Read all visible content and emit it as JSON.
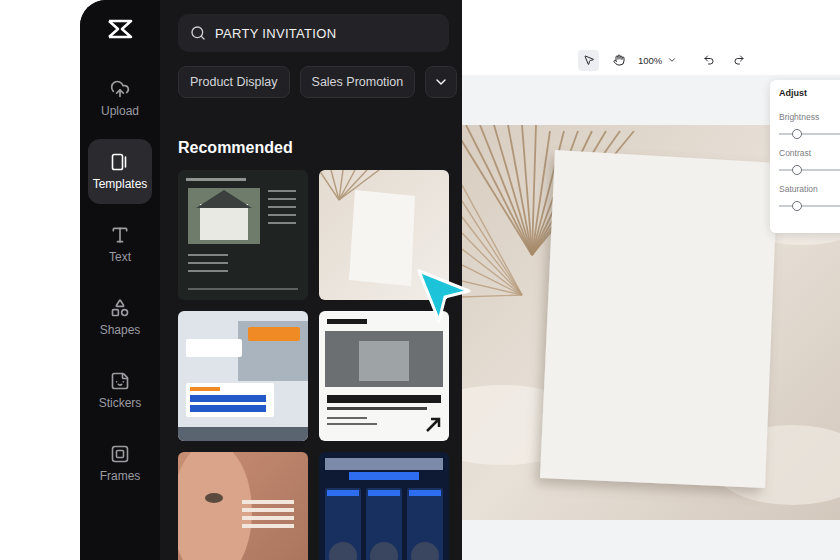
{
  "sidebar": {
    "items": [
      {
        "label": "Upload",
        "selected": false
      },
      {
        "label": "Templates",
        "selected": true
      },
      {
        "label": "Text",
        "selected": false
      },
      {
        "label": "Shapes",
        "selected": false
      },
      {
        "label": "Stickers",
        "selected": false
      },
      {
        "label": "Frames",
        "selected": false
      }
    ]
  },
  "search": {
    "value": "PARTY INVITATION"
  },
  "filters": [
    {
      "label": "Product Display"
    },
    {
      "label": "Sales Promotion"
    }
  ],
  "section": {
    "title": "Recommended"
  },
  "templates": [
    {
      "kind": "listing"
    },
    {
      "kind": "invitation"
    },
    {
      "kind": "recruiting"
    },
    {
      "kind": "poster"
    },
    {
      "kind": "portrait"
    },
    {
      "kind": "product"
    }
  ],
  "toolbar": {
    "zoom": "100%"
  },
  "adjust": {
    "title": "Adjust",
    "sliders": [
      {
        "label": "Brightness",
        "level": 0.22
      },
      {
        "label": "Contrast",
        "level": 0.22
      },
      {
        "label": "Saturation",
        "level": 0.22
      }
    ]
  }
}
